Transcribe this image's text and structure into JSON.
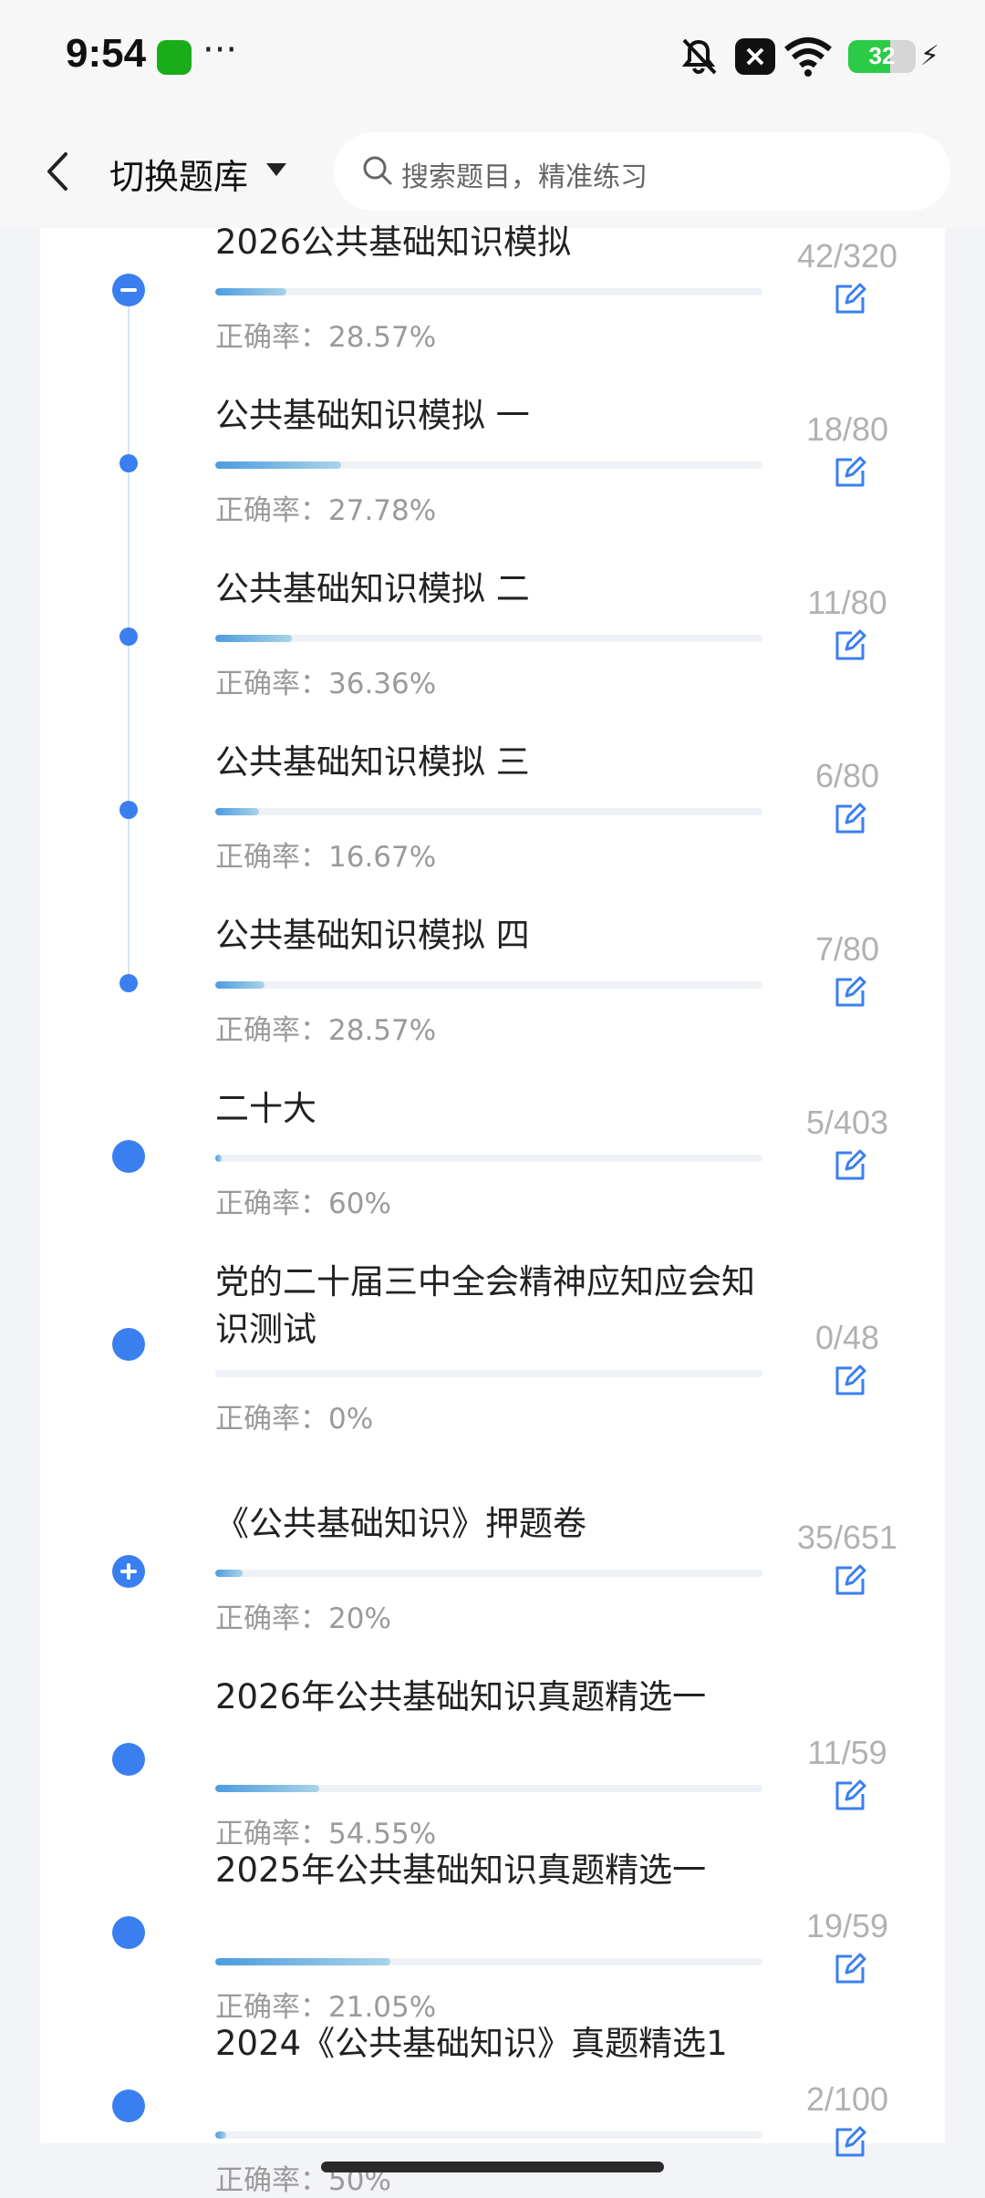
{
  "status_bar": {
    "time": "9:54",
    "more": "···",
    "battery": "32"
  },
  "header": {
    "title": "切换题库",
    "search_placeholder": "搜索题目，精准练习"
  },
  "colors": {
    "accent": "#3a7ff0",
    "progress_start": "#4d9be0",
    "progress_end": "#a9d4e8",
    "muted_text": "#9a9a9a"
  },
  "accuracy_label": "正确率：",
  "items": [
    {
      "title": "2026公共基础知识模拟",
      "accuracy": "28.57%",
      "count": "42/320",
      "progress": 0.13,
      "node": "minus"
    },
    {
      "title": "公共基础知识模拟 一",
      "accuracy": "27.78%",
      "count": "18/80",
      "progress": 0.23,
      "node": "small"
    },
    {
      "title": "公共基础知识模拟 二",
      "accuracy": "36.36%",
      "count": "11/80",
      "progress": 0.14,
      "node": "small"
    },
    {
      "title": "公共基础知识模拟 三",
      "accuracy": "16.67%",
      "count": "6/80",
      "progress": 0.08,
      "node": "small"
    },
    {
      "title": "公共基础知识模拟 四",
      "accuracy": "28.57%",
      "count": "7/80",
      "progress": 0.09,
      "node": "small"
    },
    {
      "title": "二十大",
      "accuracy": "60%",
      "count": "5/403",
      "progress": 0.012,
      "node": "dot"
    },
    {
      "title": "党的二十届三中全会精神应知应会知识测试",
      "accuracy": "0%",
      "count": "0/48",
      "progress": 0.0,
      "node": "dot"
    },
    {
      "title": "《公共基础知识》押题卷",
      "accuracy": "20%",
      "count": "35/651",
      "progress": 0.05,
      "node": "plus"
    },
    {
      "title": "2026年公共基础知识真题精选一",
      "accuracy": "54.55%",
      "count": "11/59",
      "progress": 0.19,
      "node": "dot"
    },
    {
      "title": "2025年公共基础知识真题精选一",
      "accuracy": "21.05%",
      "count": "19/59",
      "progress": 0.32,
      "node": "dot"
    },
    {
      "title": "2024《公共基础知识》真题精选1",
      "accuracy": "50%",
      "count": "2/100",
      "progress": 0.02,
      "node": "dot"
    }
  ]
}
